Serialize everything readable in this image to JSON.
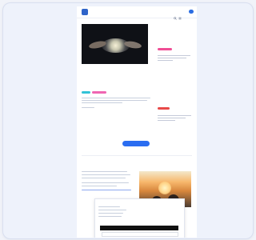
{
  "nav": {
    "logo_text": "",
    "links": [
      "",
      "",
      ""
    ]
  },
  "hero": {
    "headline": "",
    "meta": ""
  },
  "sidebar": {
    "label": "",
    "items": [
      {
        "title": "",
        "tag": ""
      },
      {
        "title": "",
        "tag": ""
      }
    ]
  },
  "section": {
    "label": "",
    "title": ""
  },
  "overlay": {
    "title": ""
  },
  "bottom": {
    "label": "",
    "title": ""
  },
  "colors": {
    "accent_blue": "#2a6df1",
    "pink_tag": "#f04e95",
    "red_tag": "#e84a49",
    "hero_dark": "#0f1116"
  }
}
